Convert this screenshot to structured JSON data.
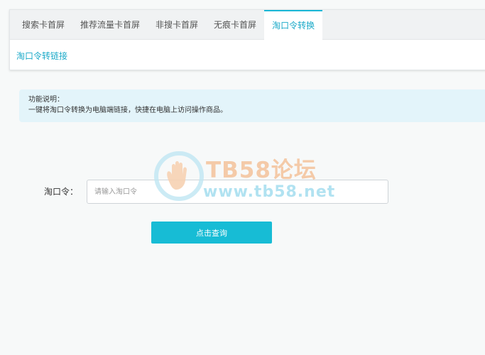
{
  "tabs": [
    {
      "label": "搜索卡首屏",
      "active": false
    },
    {
      "label": "推荐流量卡首屏",
      "active": false
    },
    {
      "label": "非搜卡首屏",
      "active": false
    },
    {
      "label": "无痕卡首屏",
      "active": false
    },
    {
      "label": "淘口令转换",
      "active": true
    }
  ],
  "sublink": "淘口令转链接",
  "notice": {
    "title": "功能说明：",
    "text": "一键将淘口令转换为电脑端链接，快捷在电脑上访问操作商品。"
  },
  "form": {
    "label": "淘口令：",
    "input_value": "",
    "input_placeholder": "请输入淘口令",
    "submit_label": "点击查询"
  },
  "watermark": {
    "title": "TB58论坛",
    "url": "www.tb58.net",
    "icon": "hand-logo-icon"
  },
  "colors": {
    "accent": "#1ab7d6",
    "notice_bg": "#e3f4fa",
    "button": "#17bcd5"
  }
}
